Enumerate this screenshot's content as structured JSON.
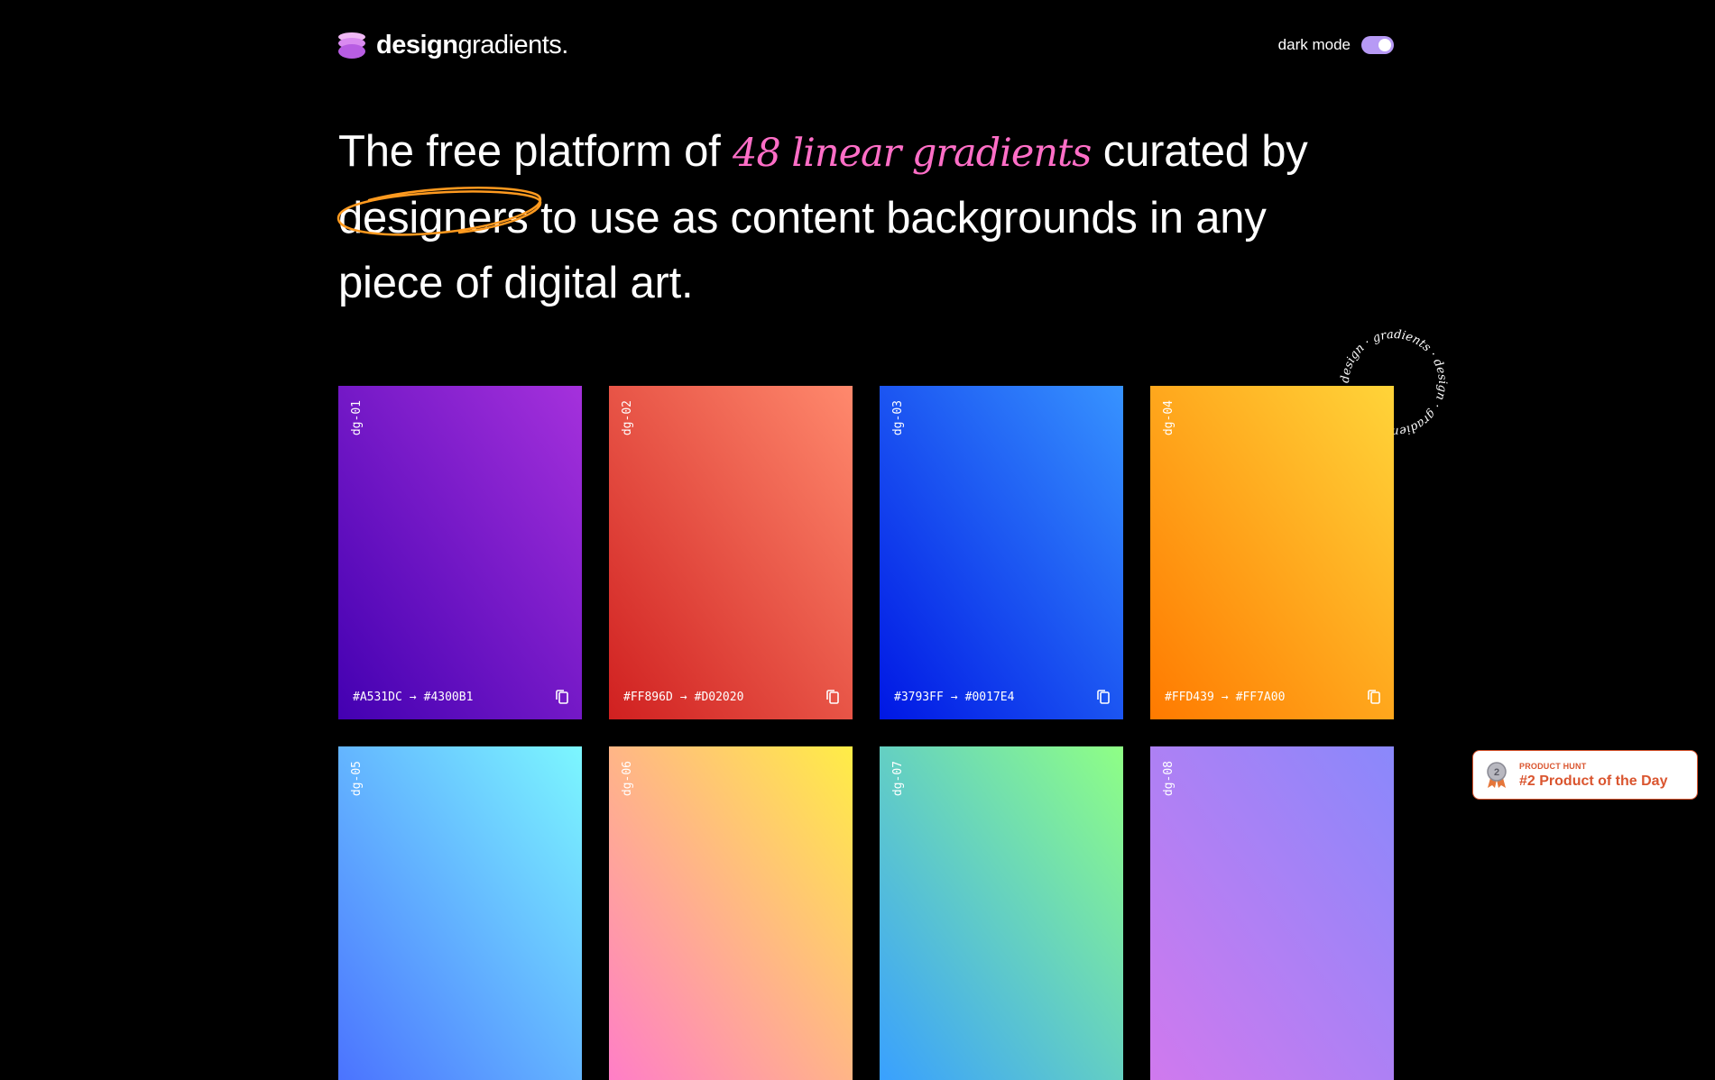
{
  "header": {
    "logo_bold": "design",
    "logo_light": "gradients.",
    "toggle_label": "dark mode"
  },
  "hero": {
    "text_1": "The free platform of ",
    "accent": "48 linear gradients",
    "text_2": " curated by ",
    "circled": "designers",
    "text_3": " to use as content backgrounds in any piece of digital art."
  },
  "stamp_text": "design · gradients · design · gradients ·",
  "cards": [
    {
      "code": "dg-01",
      "from": "#A531DC",
      "to": "#4300B1",
      "colors": [
        "#A531DC",
        "#4300B1"
      ]
    },
    {
      "code": "dg-02",
      "from": "#FF896D",
      "to": "#D02020",
      "colors": [
        "#FF896D",
        "#D02020"
      ]
    },
    {
      "code": "dg-03",
      "from": "#3793FF",
      "to": "#0017E4",
      "colors": [
        "#3793FF",
        "#0017E4"
      ]
    },
    {
      "code": "dg-04",
      "from": "#FFD439",
      "to": "#FF7A00",
      "colors": [
        "#FFD439",
        "#FF7A00"
      ]
    },
    {
      "code": "dg-05",
      "from": "",
      "to": "",
      "colors": [
        "#7CF7FF",
        "#4B73FF"
      ]
    },
    {
      "code": "dg-06",
      "from": "",
      "to": "",
      "colors": [
        "#FFED46",
        "#FF7EC7"
      ]
    },
    {
      "code": "dg-07",
      "from": "",
      "to": "",
      "colors": [
        "#8FFF85",
        "#39A0FF"
      ]
    },
    {
      "code": "dg-08",
      "from": "",
      "to": "",
      "colors": [
        "#8A88FB",
        "#D079EE"
      ]
    }
  ],
  "arrow": "→",
  "product_hunt": {
    "small": "PRODUCT HUNT",
    "big": "#2 Product of the Day",
    "rank": "2"
  }
}
